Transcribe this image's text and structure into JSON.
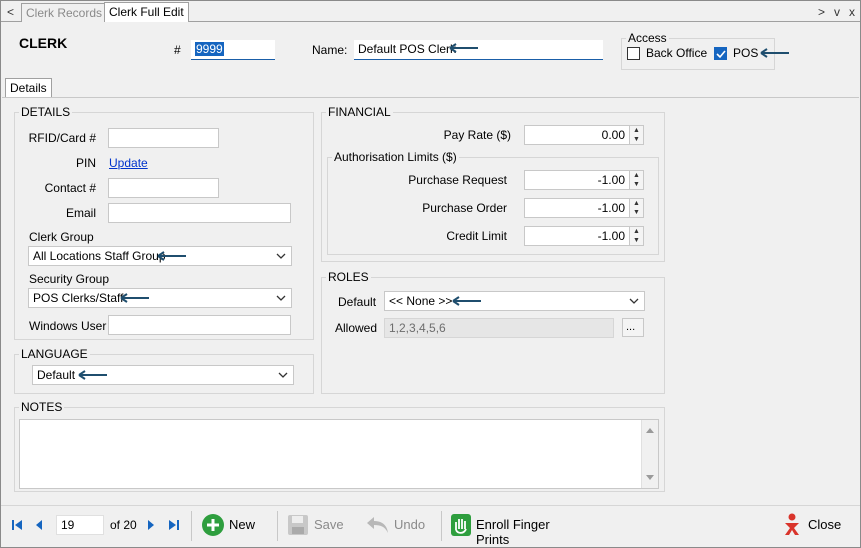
{
  "tabs": {
    "records": "Clerk Records",
    "full_edit": "Clerk Full Edit",
    "nav_left": "<",
    "nav_right": ">",
    "nav_down": "v",
    "close": "x"
  },
  "header": {
    "title": "CLERK",
    "number_label": "#",
    "number_value": "9999",
    "name_label": "Name:",
    "name_value": "Default POS Clerk",
    "access": {
      "title": "Access",
      "back_office_label": "Back Office",
      "back_office_checked": false,
      "pos_label": "POS",
      "pos_checked": true
    }
  },
  "details_tab": "Details",
  "details": {
    "title": "DETAILS",
    "rfid_label": "RFID/Card #",
    "rfid_value": "",
    "pin_label": "PIN",
    "pin_link": "Update",
    "contact_label": "Contact #",
    "contact_value": "",
    "email_label": "Email",
    "email_value": "",
    "clerk_group_label": "Clerk Group",
    "clerk_group_value": "All Locations Staff Group",
    "security_group_label": "Security Group",
    "security_group_value": "POS Clerks/Staff",
    "windows_user_label": "Windows User",
    "windows_user_value": ""
  },
  "language": {
    "title": "LANGUAGE",
    "value": "Default"
  },
  "financial": {
    "title": "FINANCIAL",
    "pay_rate_label": "Pay Rate ($)",
    "pay_rate_value": "0.00",
    "auth_title": "Authorisation Limits ($)",
    "purchase_request_label": "Purchase Request",
    "purchase_request_value": "-1.00",
    "purchase_order_label": "Purchase Order",
    "purchase_order_value": "-1.00",
    "credit_limit_label": "Credit Limit",
    "credit_limit_value": "-1.00"
  },
  "roles": {
    "title": "ROLES",
    "default_label": "Default",
    "default_value": "<< None >>",
    "allowed_label": "Allowed",
    "allowed_value": "1,2,3,4,5,6",
    "browse_label": "..."
  },
  "notes": {
    "title": "NOTES",
    "value": ""
  },
  "toolbar": {
    "record_value": "19",
    "of_label": "of 20",
    "new_label": "New",
    "save_label": "Save",
    "undo_label": "Undo",
    "enroll_label": "Enroll Finger Prints",
    "close_label": "Close"
  },
  "colors": {
    "accent": "#1a5ea8",
    "arrow": "#1f4e6e",
    "link": "#0033cc",
    "new_green": "#2e9e3e",
    "close_red": "#d9342b"
  }
}
